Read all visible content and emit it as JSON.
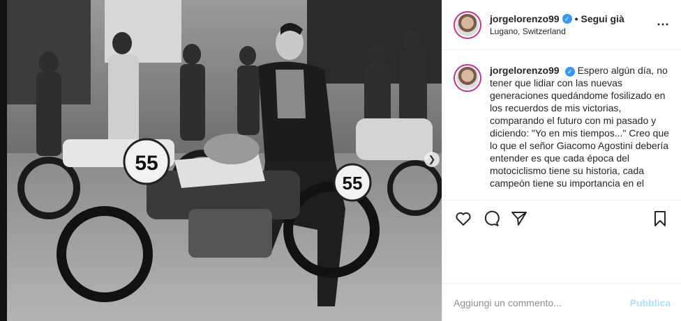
{
  "post": {
    "username": "jorgelorenzo99",
    "verified_icon": "verified-badge-icon",
    "separator": "•",
    "follow_status": "Segui già",
    "location": "Lugano, Switzerland",
    "more_icon": "more-options-icon",
    "caption": "Espero algún día, no tener que lidiar con las nuevas generaciones quedándome fosilizado en los recuerdos de mis victorias, comparando el futuro con mi pasado y diciendo: \"Yo en mis tiempos...\" Creo que lo que el señor Giacomo Agostini debería entender es que cada época del motociclismo tiene su historia, cada campeón tiene su importancia en el"
  },
  "photo": {
    "bike_number_left": "55",
    "bike_number_right": "55",
    "carousel_next_icon": "chevron-right-icon"
  },
  "actions": {
    "like_icon": "heart-icon",
    "comment_icon": "comment-icon",
    "share_icon": "paper-plane-icon",
    "save_icon": "bookmark-icon"
  },
  "comment_bar": {
    "placeholder": "Aggiungi un commento...",
    "publish_label": "Pubblica"
  },
  "colors": {
    "accent_blue": "#3897f0",
    "publish_disabled": "#b2dffc",
    "story_ring": "#c13584"
  }
}
